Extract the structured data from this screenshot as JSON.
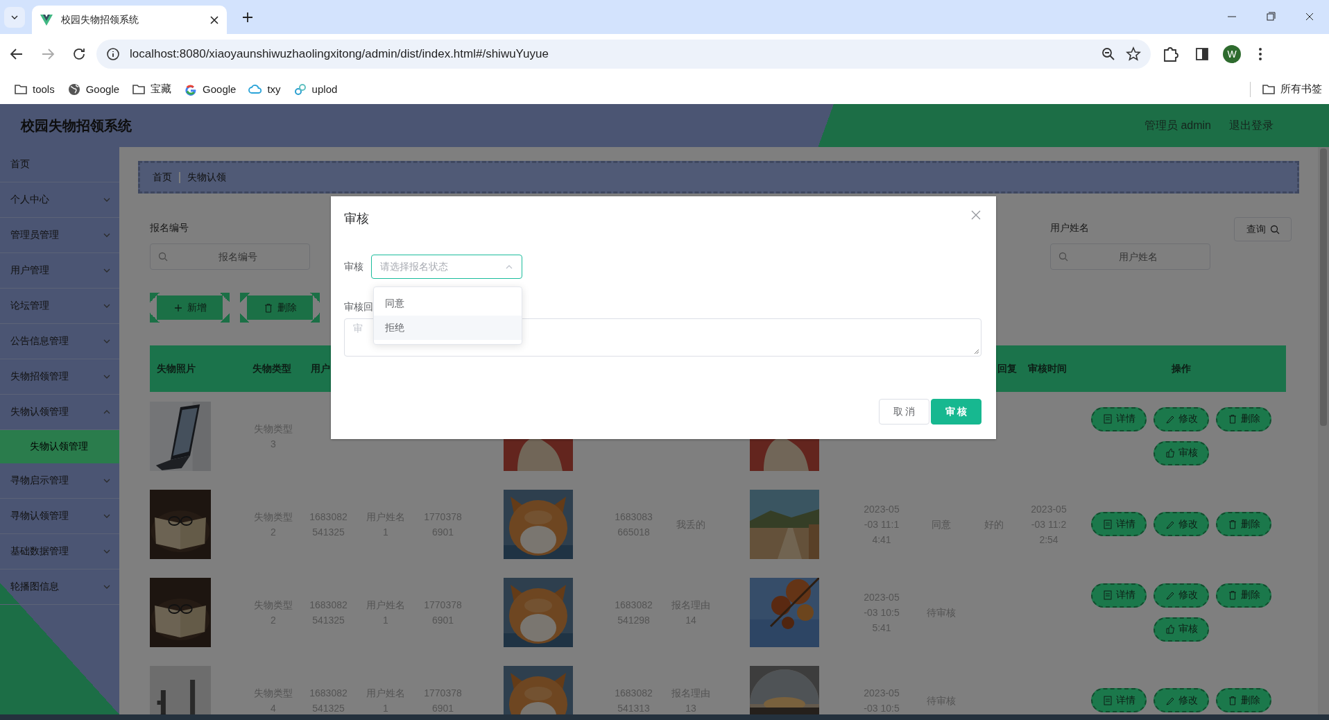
{
  "browser": {
    "tab_title": "校园失物招领系统",
    "url": "localhost:8080/xiaoyaunshiwuzhaolingxitong/admin/dist/index.html#/shiwuYuyue",
    "profile_initial": "W",
    "bookmarks": [
      {
        "label": "tools",
        "kind": "folder"
      },
      {
        "label": "Google",
        "kind": "globe"
      },
      {
        "label": "宝藏",
        "kind": "folder"
      },
      {
        "label": "Google",
        "kind": "google"
      },
      {
        "label": "txy",
        "kind": "cloud"
      },
      {
        "label": "uplod",
        "kind": "link"
      }
    ],
    "all_bookmarks": "所有书签"
  },
  "header": {
    "title": "校园失物招领系统",
    "user": "管理员 admin",
    "logout": "退出登录"
  },
  "sidebar": {
    "items": [
      {
        "label": "首页",
        "expandable": false
      },
      {
        "label": "个人中心",
        "expandable": true,
        "expanded": false
      },
      {
        "label": "管理员管理",
        "expandable": true,
        "expanded": false
      },
      {
        "label": "用户管理",
        "expandable": true,
        "expanded": false
      },
      {
        "label": "论坛管理",
        "expandable": true,
        "expanded": false
      },
      {
        "label": "公告信息管理",
        "expandable": true,
        "expanded": false
      },
      {
        "label": "失物招领管理",
        "expandable": true,
        "expanded": false
      },
      {
        "label": "失物认领管理",
        "expandable": true,
        "expanded": true,
        "children": [
          {
            "label": "失物认领管理",
            "selected": true
          }
        ]
      },
      {
        "label": "寻物启示管理",
        "expandable": true,
        "expanded": false
      },
      {
        "label": "寻物认领管理",
        "expandable": true,
        "expanded": false
      },
      {
        "label": "基础数据管理",
        "expandable": true,
        "expanded": false
      },
      {
        "label": "轮播图信息",
        "expandable": true,
        "expanded": false
      }
    ]
  },
  "breadcrumb": [
    "首页",
    "失物认领"
  ],
  "search": {
    "fields": [
      {
        "label": "报名编号",
        "placeholder": "报名编号"
      },
      {
        "label": "用户姓名",
        "placeholder": "用户姓名"
      }
    ],
    "query_button": "查询"
  },
  "toolbar": [
    {
      "label": "新增",
      "kind": "add"
    },
    {
      "label": "删除",
      "kind": "delete"
    }
  ],
  "table": {
    "columns": [
      "失物照片",
      "失物类型",
      "用户",
      null,
      null,
      null,
      null,
      null,
      null,
      null,
      null,
      "回复",
      "审核时间",
      "操作"
    ],
    "rows": [
      {
        "cells": [
          {
            "kind": "picture"
          },
          "失物类型 3",
          null,
          null,
          null,
          {
            "kind": "picture"
          },
          null,
          null,
          {
            "kind": "picture"
          },
          null,
          null,
          null,
          null
        ],
        "actions": [
          {
            "label": "详情",
            "kind": "detail"
          },
          {
            "label": "修改",
            "kind": "edit"
          },
          {
            "label": "删除",
            "kind": "delete"
          },
          {
            "label": "审核",
            "kind": "review"
          }
        ]
      },
      {
        "cells": [
          {
            "kind": "picture"
          },
          "失物类型 2",
          "1683082541325",
          "用户姓名 1",
          "17703786901",
          {
            "kind": "picture"
          },
          "1683083665018",
          "我丢的",
          {
            "kind": "picture"
          },
          "2023-05-03 11:14:41",
          "同意",
          "好的",
          "2023-05-03 11:22:54"
        ],
        "actions": [
          {
            "label": "详情",
            "kind": "detail"
          },
          {
            "label": "修改",
            "kind": "edit"
          },
          {
            "label": "删除",
            "kind": "delete"
          }
        ]
      },
      {
        "cells": [
          {
            "kind": "picture"
          },
          "失物类型 2",
          "1683082541325",
          "用户姓名 1",
          "17703786901",
          {
            "kind": "picture"
          },
          "1683082541298",
          "报名理由 14",
          {
            "kind": "picture"
          },
          "2023-05-03 10:55:41",
          "待审核",
          null,
          null
        ],
        "actions": [
          {
            "label": "详情",
            "kind": "detail"
          },
          {
            "label": "修改",
            "kind": "edit"
          },
          {
            "label": "删除",
            "kind": "delete"
          },
          {
            "label": "审核",
            "kind": "review"
          }
        ]
      },
      {
        "cells": [
          {
            "kind": "picture"
          },
          "失物类型 4",
          "1683082541325",
          "用户姓名 1",
          "17703786901",
          {
            "kind": "picture"
          },
          "1683082541313",
          "报名理由 13",
          {
            "kind": "picture"
          },
          "2023-05-03 10:5",
          "待审核",
          null,
          null
        ],
        "actions": [
          {
            "label": "详情",
            "kind": "detail"
          },
          {
            "label": "修改",
            "kind": "edit"
          },
          {
            "label": "删除",
            "kind": "delete"
          }
        ]
      }
    ]
  },
  "dialog": {
    "title": "审核",
    "status_label": "审核",
    "status_placeholder": "请选择报名状态",
    "status_open": true,
    "options": [
      {
        "label": "同意",
        "hovered": false
      },
      {
        "label": "拒绝",
        "hovered": true
      }
    ],
    "reply_label": "审核回",
    "reply_placeholder": "审",
    "buttons": [
      {
        "label": "取 消",
        "kind": "secondary"
      },
      {
        "label": "审 核",
        "kind": "primary"
      }
    ]
  }
}
